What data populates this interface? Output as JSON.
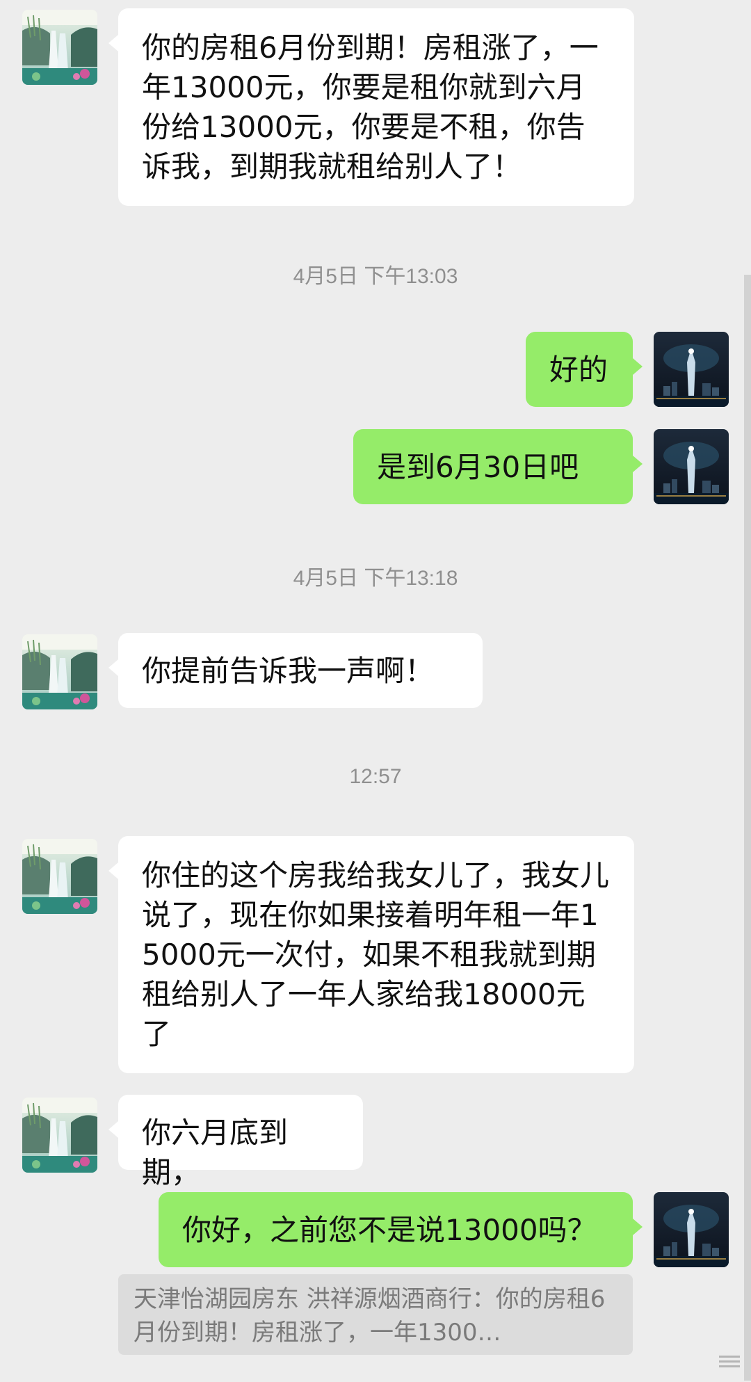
{
  "timestamps": {
    "t1": "4月5日 下午13:03",
    "t2": "4月5日 下午13:18",
    "t3": "12:57"
  },
  "messages": [
    {
      "from": "landlord",
      "text": "你的房租6月份到期！房租涨了，一年13000元，你要是租你就到六月份给13000元，你要是不租，你告诉我，到期我就租给别人了！"
    },
    {
      "from": "me",
      "text": "好的"
    },
    {
      "from": "me",
      "text": "是到6月30日吧"
    },
    {
      "from": "landlord",
      "text": "你提前告诉我一声啊！"
    },
    {
      "from": "landlord",
      "text": "你住的这个房我给我女儿了，我女儿说了，现在你如果接着明年租一年15000元一次付，如果不租我就到期租给别人了一年人家给我18000元了"
    },
    {
      "from": "landlord",
      "text": "你六月底到期，"
    },
    {
      "from": "me",
      "text": "你好，之前您不是说13000吗？"
    }
  ],
  "quote": {
    "text": "天津怡湖园房东 洪祥源烟酒商行：你的房租6月份到期！房租涨了，一年1300…"
  },
  "colors": {
    "background": "#ededed",
    "incoming_bubble": "#ffffff",
    "outgoing_bubble": "#95ec69",
    "timestamp_text": "#8f8f8f",
    "quote_background": "#dcdcdc"
  },
  "icons": {
    "landlord_avatar": "waterfall-landscape-avatar",
    "my_avatar": "night-city-tower-avatar"
  }
}
